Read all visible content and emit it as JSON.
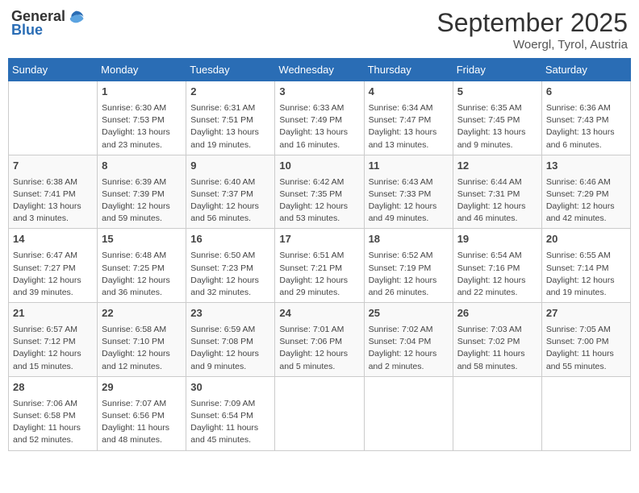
{
  "header": {
    "logo_general": "General",
    "logo_blue": "Blue",
    "month_title": "September 2025",
    "location": "Woergl, Tyrol, Austria"
  },
  "days_of_week": [
    "Sunday",
    "Monday",
    "Tuesday",
    "Wednesday",
    "Thursday",
    "Friday",
    "Saturday"
  ],
  "weeks": [
    [
      {
        "day": "",
        "content": ""
      },
      {
        "day": "1",
        "content": "Sunrise: 6:30 AM\nSunset: 7:53 PM\nDaylight: 13 hours\nand 23 minutes."
      },
      {
        "day": "2",
        "content": "Sunrise: 6:31 AM\nSunset: 7:51 PM\nDaylight: 13 hours\nand 19 minutes."
      },
      {
        "day": "3",
        "content": "Sunrise: 6:33 AM\nSunset: 7:49 PM\nDaylight: 13 hours\nand 16 minutes."
      },
      {
        "day": "4",
        "content": "Sunrise: 6:34 AM\nSunset: 7:47 PM\nDaylight: 13 hours\nand 13 minutes."
      },
      {
        "day": "5",
        "content": "Sunrise: 6:35 AM\nSunset: 7:45 PM\nDaylight: 13 hours\nand 9 minutes."
      },
      {
        "day": "6",
        "content": "Sunrise: 6:36 AM\nSunset: 7:43 PM\nDaylight: 13 hours\nand 6 minutes."
      }
    ],
    [
      {
        "day": "7",
        "content": "Sunrise: 6:38 AM\nSunset: 7:41 PM\nDaylight: 13 hours\nand 3 minutes."
      },
      {
        "day": "8",
        "content": "Sunrise: 6:39 AM\nSunset: 7:39 PM\nDaylight: 12 hours\nand 59 minutes."
      },
      {
        "day": "9",
        "content": "Sunrise: 6:40 AM\nSunset: 7:37 PM\nDaylight: 12 hours\nand 56 minutes."
      },
      {
        "day": "10",
        "content": "Sunrise: 6:42 AM\nSunset: 7:35 PM\nDaylight: 12 hours\nand 53 minutes."
      },
      {
        "day": "11",
        "content": "Sunrise: 6:43 AM\nSunset: 7:33 PM\nDaylight: 12 hours\nand 49 minutes."
      },
      {
        "day": "12",
        "content": "Sunrise: 6:44 AM\nSunset: 7:31 PM\nDaylight: 12 hours\nand 46 minutes."
      },
      {
        "day": "13",
        "content": "Sunrise: 6:46 AM\nSunset: 7:29 PM\nDaylight: 12 hours\nand 42 minutes."
      }
    ],
    [
      {
        "day": "14",
        "content": "Sunrise: 6:47 AM\nSunset: 7:27 PM\nDaylight: 12 hours\nand 39 minutes."
      },
      {
        "day": "15",
        "content": "Sunrise: 6:48 AM\nSunset: 7:25 PM\nDaylight: 12 hours\nand 36 minutes."
      },
      {
        "day": "16",
        "content": "Sunrise: 6:50 AM\nSunset: 7:23 PM\nDaylight: 12 hours\nand 32 minutes."
      },
      {
        "day": "17",
        "content": "Sunrise: 6:51 AM\nSunset: 7:21 PM\nDaylight: 12 hours\nand 29 minutes."
      },
      {
        "day": "18",
        "content": "Sunrise: 6:52 AM\nSunset: 7:19 PM\nDaylight: 12 hours\nand 26 minutes."
      },
      {
        "day": "19",
        "content": "Sunrise: 6:54 AM\nSunset: 7:16 PM\nDaylight: 12 hours\nand 22 minutes."
      },
      {
        "day": "20",
        "content": "Sunrise: 6:55 AM\nSunset: 7:14 PM\nDaylight: 12 hours\nand 19 minutes."
      }
    ],
    [
      {
        "day": "21",
        "content": "Sunrise: 6:57 AM\nSunset: 7:12 PM\nDaylight: 12 hours\nand 15 minutes."
      },
      {
        "day": "22",
        "content": "Sunrise: 6:58 AM\nSunset: 7:10 PM\nDaylight: 12 hours\nand 12 minutes."
      },
      {
        "day": "23",
        "content": "Sunrise: 6:59 AM\nSunset: 7:08 PM\nDaylight: 12 hours\nand 9 minutes."
      },
      {
        "day": "24",
        "content": "Sunrise: 7:01 AM\nSunset: 7:06 PM\nDaylight: 12 hours\nand 5 minutes."
      },
      {
        "day": "25",
        "content": "Sunrise: 7:02 AM\nSunset: 7:04 PM\nDaylight: 12 hours\nand 2 minutes."
      },
      {
        "day": "26",
        "content": "Sunrise: 7:03 AM\nSunset: 7:02 PM\nDaylight: 11 hours\nand 58 minutes."
      },
      {
        "day": "27",
        "content": "Sunrise: 7:05 AM\nSunset: 7:00 PM\nDaylight: 11 hours\nand 55 minutes."
      }
    ],
    [
      {
        "day": "28",
        "content": "Sunrise: 7:06 AM\nSunset: 6:58 PM\nDaylight: 11 hours\nand 52 minutes."
      },
      {
        "day": "29",
        "content": "Sunrise: 7:07 AM\nSunset: 6:56 PM\nDaylight: 11 hours\nand 48 minutes."
      },
      {
        "day": "30",
        "content": "Sunrise: 7:09 AM\nSunset: 6:54 PM\nDaylight: 11 hours\nand 45 minutes."
      },
      {
        "day": "",
        "content": ""
      },
      {
        "day": "",
        "content": ""
      },
      {
        "day": "",
        "content": ""
      },
      {
        "day": "",
        "content": ""
      }
    ]
  ]
}
